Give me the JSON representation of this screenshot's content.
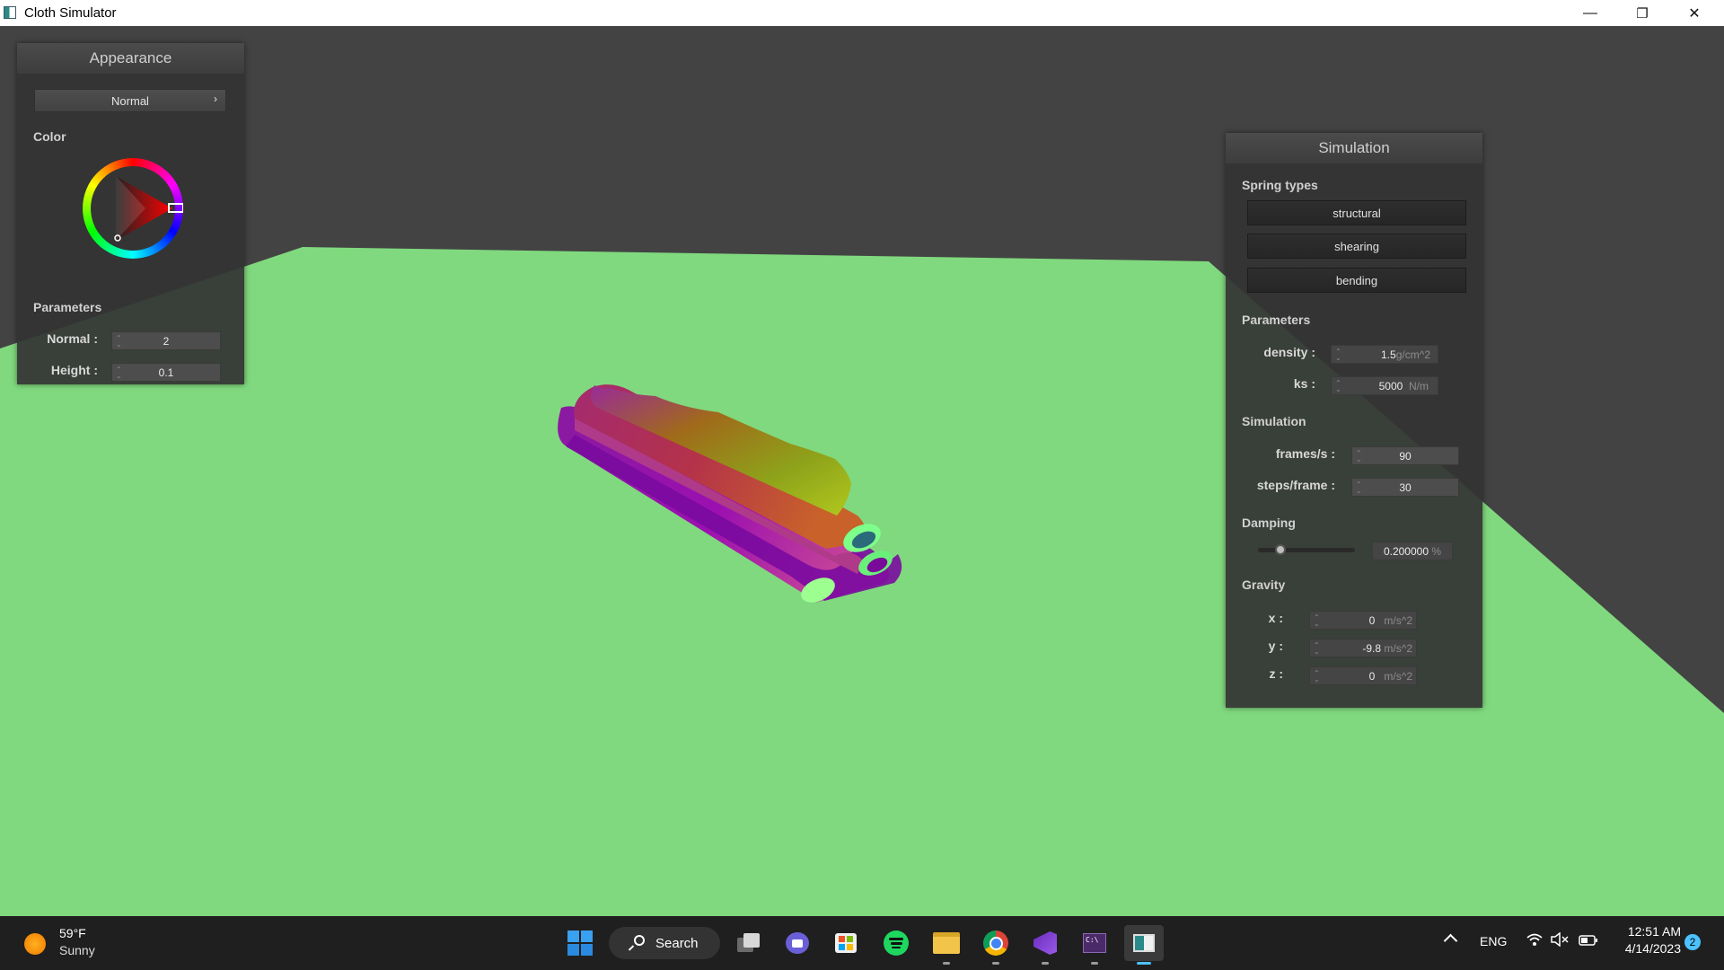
{
  "window": {
    "title": "Cloth Simulator",
    "minimize": "—",
    "restore": "❐",
    "close": "✕"
  },
  "appearance": {
    "title": "Appearance",
    "mode": "Normal",
    "color_label": "Color",
    "params_label": "Parameters",
    "normal_label": "Normal :",
    "normal_value": "2",
    "height_label": "Height :",
    "height_value": "0.1"
  },
  "simulation": {
    "title": "Simulation",
    "spring_types_label": "Spring types",
    "spring_types": [
      "structural",
      "shearing",
      "bending"
    ],
    "params_label": "Parameters",
    "density_label": "density :",
    "density_value": "1.5",
    "density_unit": "g/cm^2",
    "ks_label": "ks :",
    "ks_value": "5000",
    "ks_unit": "N/m",
    "sim_label": "Simulation",
    "fps_label": "frames/s :",
    "fps_value": "90",
    "steps_label": "steps/frame :",
    "steps_value": "30",
    "damping_label": "Damping",
    "damping_value": "0.200000",
    "damping_unit": "%",
    "damping_fraction": 0.2,
    "gravity_label": "Gravity",
    "gx_label": "x :",
    "gx_value": "0",
    "gy_label": "y :",
    "gy_value": "-9.8",
    "gz_label": "z :",
    "gz_value": "0",
    "g_unit": "m/s^2"
  },
  "colors": {
    "floor": "#80d97e",
    "background": "#434343",
    "panel": "#343434"
  },
  "taskbar": {
    "weather_temp": "59°F",
    "weather_cond": "Sunny",
    "search_label": "Search",
    "lang": "ENG",
    "time": "12:51 AM",
    "date": "4/14/2023",
    "notif_count": "2",
    "apps": [
      "start-icon",
      "task-view-icon",
      "teams-chat-icon",
      "store-icon",
      "spotify-icon",
      "file-explorer-icon",
      "chrome-icon",
      "visual-studio-icon",
      "terminal-icon",
      "cloth-simulator-taskbar-icon"
    ]
  }
}
